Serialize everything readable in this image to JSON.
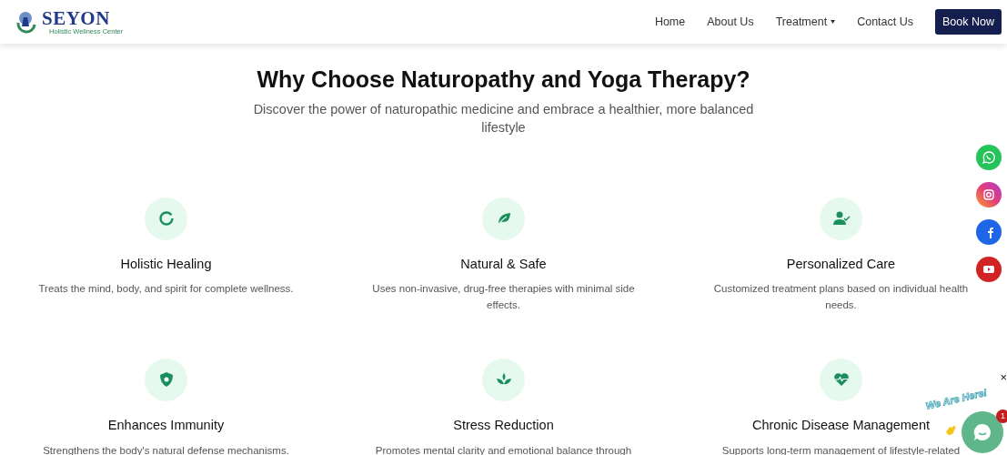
{
  "brand": {
    "name": "SEYON",
    "tagline": "Holistic Wellness Center"
  },
  "nav": [
    {
      "label": "Home",
      "dropdown": false
    },
    {
      "label": "About Us",
      "dropdown": false
    },
    {
      "label": "Treatment",
      "dropdown": true
    },
    {
      "label": "Contact Us",
      "dropdown": false
    }
  ],
  "cta": "Book Now",
  "heading": "Why Choose Naturopathy and Yoga Therapy?",
  "subtitle": "Discover the power of naturopathic medicine and embrace a healthier, more balanced lifestyle",
  "features": [
    {
      "kind": "ring",
      "title": "Holistic Healing",
      "text": "Treats the mind, body, and spirit for complete wellness."
    },
    {
      "kind": "leaf",
      "title": "Natural & Safe",
      "text": "Uses non-invasive, drug-free therapies with minimal side effects."
    },
    {
      "kind": "person",
      "title": "Personalized Care",
      "text": "Customized treatment plans based on individual health needs."
    },
    {
      "kind": "shield",
      "title": "Enhances Immunity",
      "text": "Strengthens the body's natural defense mechanisms."
    },
    {
      "kind": "lotus",
      "title": "Stress Reduction",
      "text": "Promotes mental clarity and emotional balance through"
    },
    {
      "kind": "heart",
      "title": "Chronic Disease Management",
      "text": "Supports long-term management of lifestyle-related"
    }
  ],
  "social": [
    {
      "kind": "whatsapp"
    },
    {
      "kind": "instagram"
    },
    {
      "kind": "facebook"
    },
    {
      "kind": "youtube"
    }
  ],
  "chat": {
    "label": "We Are Here!",
    "badge": "1",
    "close": "×"
  }
}
